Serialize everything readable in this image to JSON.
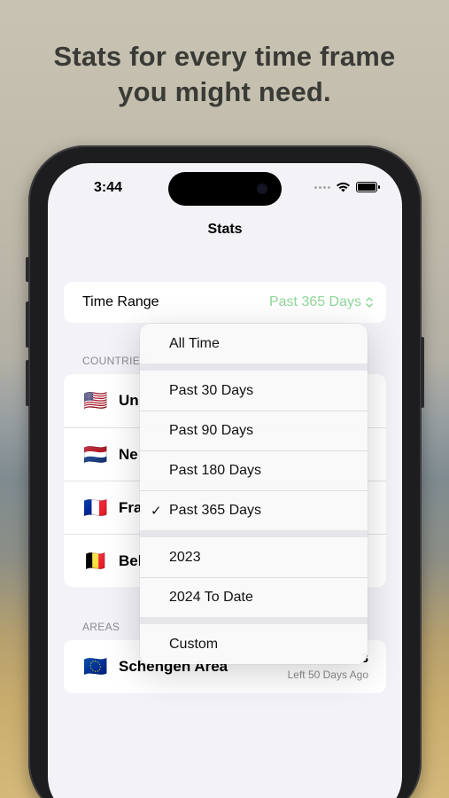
{
  "headline": {
    "line1": "Stats for every time frame",
    "line2": "you might need."
  },
  "status_bar": {
    "time": "3:44",
    "icons": [
      "signal-dots-icon",
      "wifi-icon",
      "battery-icon"
    ]
  },
  "nav": {
    "title": "Stats"
  },
  "time_range": {
    "label": "Time Range",
    "value": "Past 365 Days",
    "accent_color": "#8fd69a"
  },
  "countries": {
    "header": "COUNTRIES",
    "items": [
      {
        "flag": "🇺🇸",
        "name": "Un"
      },
      {
        "flag": "🇳🇱",
        "name": "Ne"
      },
      {
        "flag": "🇫🇷",
        "name": "Fra"
      },
      {
        "flag": "🇧🇪",
        "name": "Bel"
      }
    ]
  },
  "areas": {
    "header": "AREAS",
    "items": [
      {
        "flag": "🇪🇺",
        "name": "Schengen Area",
        "days": "3",
        "sub": "Left 50 Days Ago"
      }
    ]
  },
  "menu": {
    "groups": [
      [
        {
          "label": "All Time",
          "checked": false
        }
      ],
      [
        {
          "label": "Past 30 Days",
          "checked": false
        },
        {
          "label": "Past 90 Days",
          "checked": false
        },
        {
          "label": "Past 180 Days",
          "checked": false
        },
        {
          "label": "Past 365 Days",
          "checked": true
        }
      ],
      [
        {
          "label": "2023",
          "checked": false
        },
        {
          "label": "2024 To Date",
          "checked": false
        }
      ],
      [
        {
          "label": "Custom",
          "checked": false
        }
      ]
    ],
    "check_mark": "✓"
  }
}
